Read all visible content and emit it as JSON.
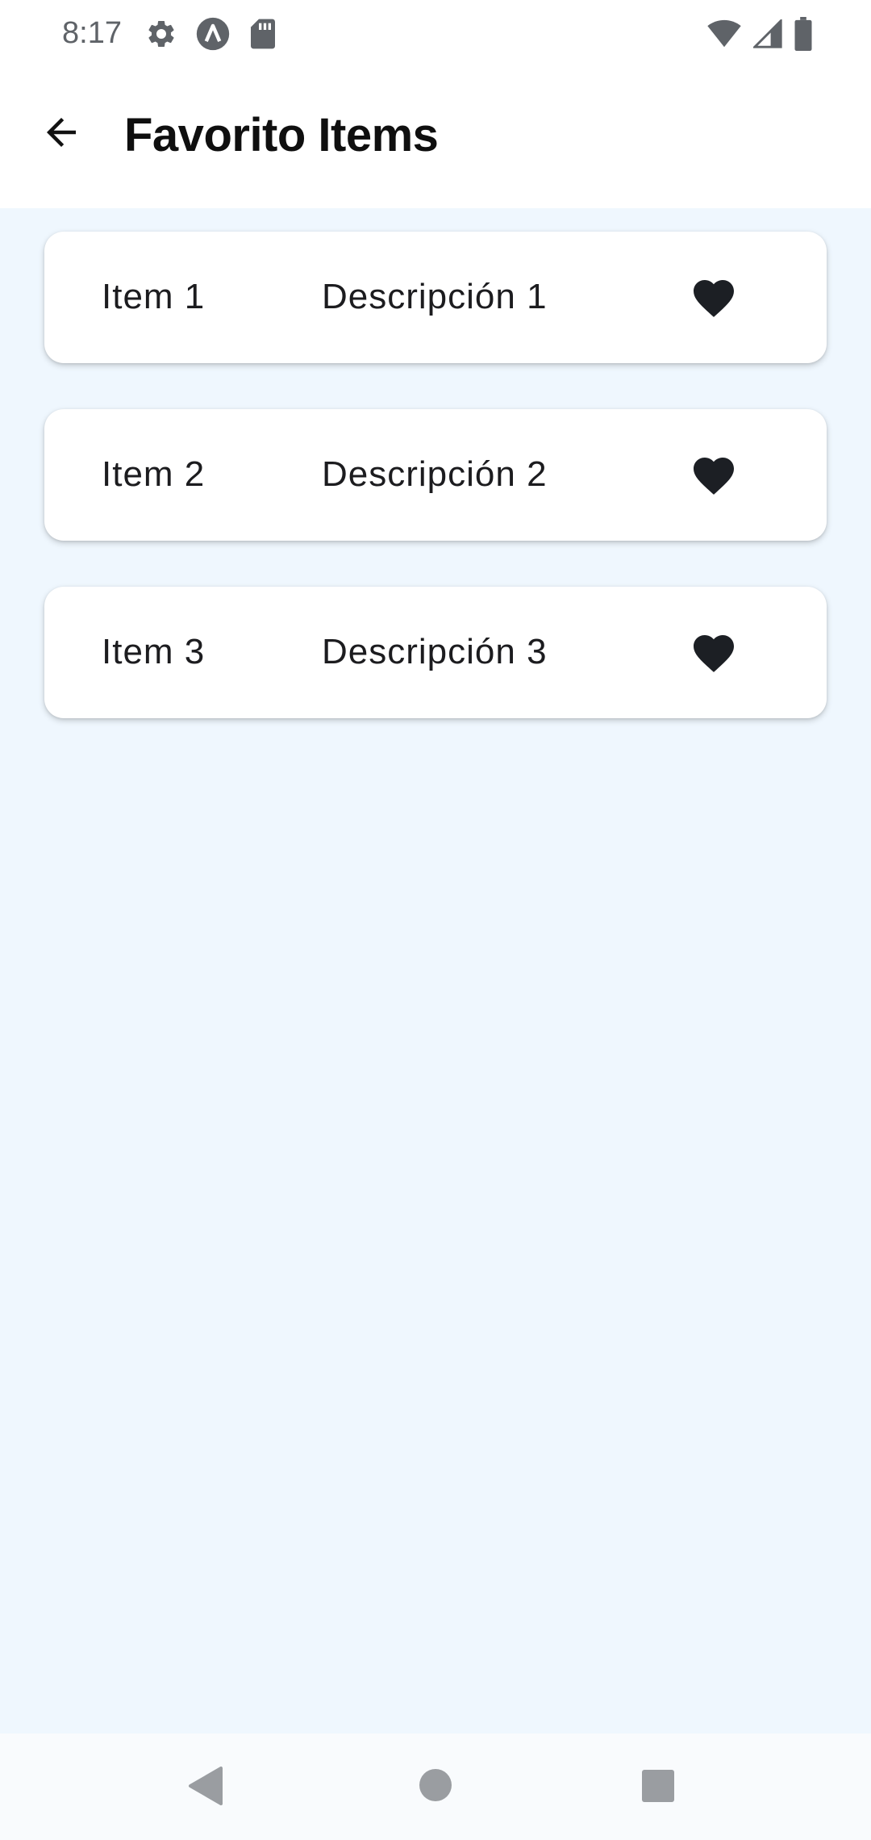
{
  "status_bar": {
    "time": "8:17",
    "left_icons": [
      "settings-icon",
      "app-a-icon",
      "sd-card-icon"
    ],
    "right_icons": [
      "wifi-icon",
      "cellular-signal-icon",
      "battery-icon"
    ]
  },
  "app_bar": {
    "title": "Favorito Items",
    "back_icon": "arrow-back-icon"
  },
  "items": [
    {
      "title": "Item 1",
      "description": "Descripción 1",
      "favorite_icon": "heart-icon"
    },
    {
      "title": "Item 2",
      "description": "Descripción 2",
      "favorite_icon": "heart-icon"
    },
    {
      "title": "Item 3",
      "description": "Descripción 3",
      "favorite_icon": "heart-icon"
    }
  ],
  "navigation_bar": {
    "buttons": [
      "nav-back-icon",
      "nav-home-icon",
      "nav-recents-icon"
    ]
  },
  "colors": {
    "content_background": "#eff7fe",
    "card_background": "#ffffff",
    "heart": "#1c1f24",
    "text": "#1c1c1f"
  }
}
